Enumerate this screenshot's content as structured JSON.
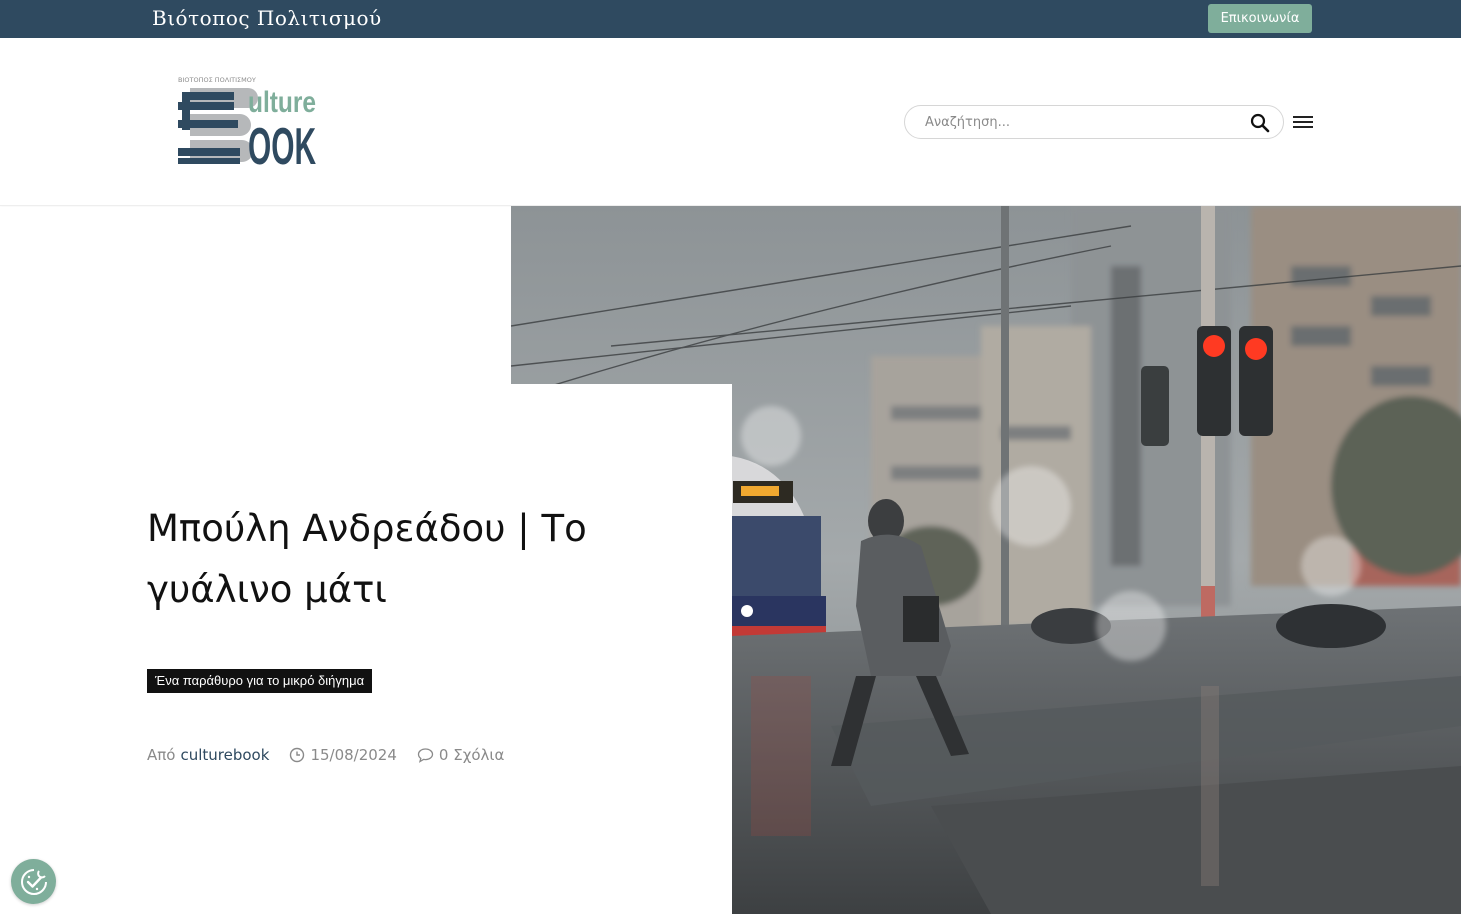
{
  "topbar": {
    "site_name": "Βιότοπος Πολιτισμού",
    "contact_label": "Επικοινωνία"
  },
  "header": {
    "logo": {
      "small_text": "ΒΙΟΤΟΠΟΣ ΠΟΛΙΤΙΣΜΟΥ",
      "word_top": "ulture",
      "word_bottom": "OOK"
    },
    "search": {
      "placeholder": "Αναζήτηση..."
    }
  },
  "post": {
    "title": "Μπούλη Ανδρεάδου | Το γυάλινο μάτι",
    "category": "Ένα παράθυρο για το μικρό διήγημα",
    "by_label": "Από",
    "author": "culturebook",
    "date": "15/08/2024",
    "comments": "0 Σχόλια"
  },
  "colors": {
    "topbar": "#2f4a60",
    "accent": "#7fae9b",
    "logo_dark": "#2f4a60",
    "logo_gray": "#b6b8ba"
  }
}
